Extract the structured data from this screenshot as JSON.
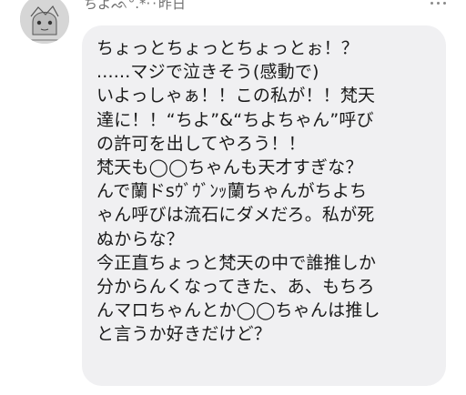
{
  "post": {
    "author": "ちよ",
    "author_decoration": "ᨒ°.*·",
    "separator": "·",
    "time": "昨日",
    "avatar_icon": "avatar-drawing-icon",
    "more_icon": "more-options-icon",
    "body": "ちょっとちょっとちょっとぉ！？\n......マジで泣きそう(感動で)\nいよっしゃぁ！！この私が！！梵天\n達に！！“ちよ”&“ちよちゃん”呼び\nの許可を出してやろう！！\n梵天も◯◯ちゃんも天才すぎな？\nんで蘭ドsｳﾞｳﾞﾝｯ蘭ちゃんがちよち\nゃん呼びは流石にダメだろ。私が死\nぬからな？\n今正直ちょっと梵天の中で誰推しか\n分からんくなってきた、あ、もちろ\nんマロちゃんとか◯◯ちゃんは推し\nと言うか好きだけど？"
  },
  "colors": {
    "bubble": "#f0f0f2",
    "text": "#1a1a1a",
    "meta": "#6f6f6f"
  }
}
